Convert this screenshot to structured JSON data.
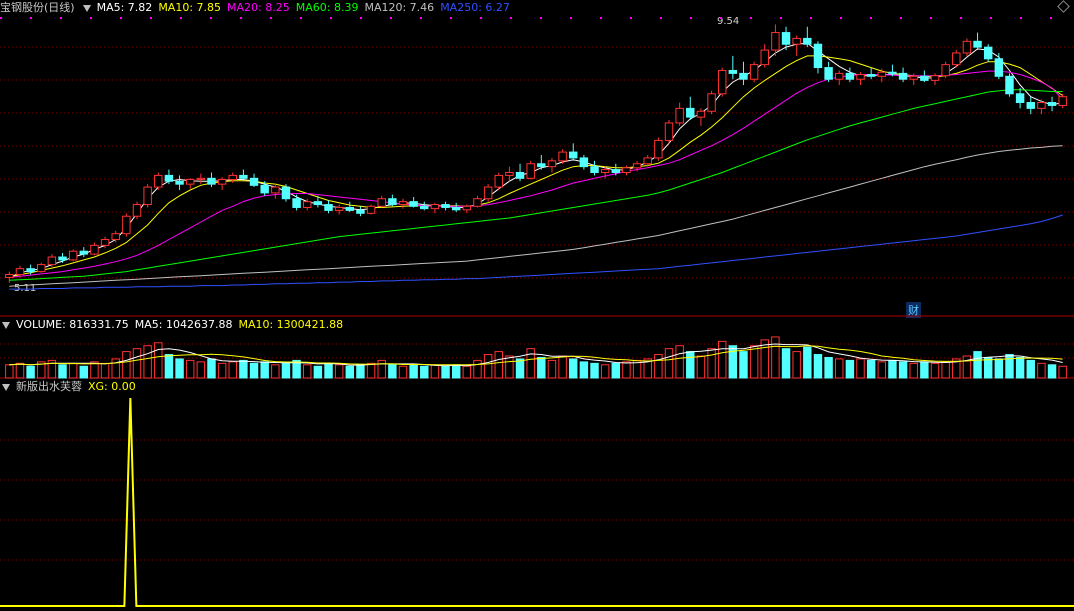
{
  "price_panel": {
    "stock_name": "宝钢股份(日线)",
    "ma_labels": [
      {
        "text": "MA5: 7.82",
        "color": "#ffffff"
      },
      {
        "text": "MA10: 7.85",
        "color": "#ffff00"
      },
      {
        "text": "MA20: 8.25",
        "color": "#ff00ff"
      },
      {
        "text": "MA60: 8.39",
        "color": "#00ff00"
      },
      {
        "text": "MA120: 7.46",
        "color": "#c0c0c0"
      },
      {
        "text": "MA250: 6.27",
        "color": "#3050ff"
      }
    ],
    "high_label": "9.54",
    "low_label": "5.11",
    "event_marker": "财"
  },
  "volume_panel": {
    "label": "VOLUME: 816331.75",
    "ma5": "MA5: 1042637.88",
    "ma10": "MA10: 1300421.88"
  },
  "indicator_panel": {
    "name": "新版出水芙蓉",
    "xg": "XG: 0.00"
  },
  "colors": {
    "up": "#ff3232",
    "down": "#54ffff",
    "grid": "#7a0000",
    "indicator": "#ffff00"
  },
  "chart_data": {
    "type": "candlestick",
    "price_range": [
      5.11,
      9.54
    ],
    "ohlc": [
      [
        5.2,
        5.3,
        5.11,
        5.25
      ],
      [
        5.25,
        5.4,
        5.2,
        5.35
      ],
      [
        5.35,
        5.42,
        5.25,
        5.3
      ],
      [
        5.3,
        5.45,
        5.28,
        5.42
      ],
      [
        5.42,
        5.6,
        5.38,
        5.55
      ],
      [
        5.55,
        5.62,
        5.45,
        5.5
      ],
      [
        5.5,
        5.68,
        5.48,
        5.65
      ],
      [
        5.65,
        5.72,
        5.55,
        5.6
      ],
      [
        5.6,
        5.8,
        5.58,
        5.75
      ],
      [
        5.75,
        5.9,
        5.7,
        5.85
      ],
      [
        5.85,
        6.0,
        5.8,
        5.95
      ],
      [
        5.95,
        6.3,
        5.9,
        6.25
      ],
      [
        6.25,
        6.5,
        6.2,
        6.45
      ],
      [
        6.45,
        6.8,
        6.4,
        6.75
      ],
      [
        6.75,
        7.0,
        6.7,
        6.95
      ],
      [
        6.95,
        7.05,
        6.8,
        6.85
      ],
      [
        6.85,
        6.95,
        6.7,
        6.8
      ],
      [
        6.8,
        6.9,
        6.72,
        6.88
      ],
      [
        6.88,
        6.98,
        6.8,
        6.9
      ],
      [
        6.9,
        7.0,
        6.75,
        6.8
      ],
      [
        6.8,
        6.92,
        6.7,
        6.88
      ],
      [
        6.88,
        7.0,
        6.82,
        6.95
      ],
      [
        6.95,
        7.05,
        6.85,
        6.9
      ],
      [
        6.9,
        6.98,
        6.75,
        6.78
      ],
      [
        6.78,
        6.85,
        6.6,
        6.65
      ],
      [
        6.65,
        6.8,
        6.55,
        6.75
      ],
      [
        6.75,
        6.8,
        6.5,
        6.55
      ],
      [
        6.55,
        6.62,
        6.35,
        6.4
      ],
      [
        6.4,
        6.55,
        6.35,
        6.5
      ],
      [
        6.5,
        6.6,
        6.4,
        6.45
      ],
      [
        6.45,
        6.52,
        6.3,
        6.35
      ],
      [
        6.35,
        6.45,
        6.28,
        6.4
      ],
      [
        6.4,
        6.5,
        6.32,
        6.35
      ],
      [
        6.35,
        6.42,
        6.25,
        6.3
      ],
      [
        6.3,
        6.45,
        6.28,
        6.42
      ],
      [
        6.42,
        6.6,
        6.4,
        6.55
      ],
      [
        6.55,
        6.62,
        6.42,
        6.45
      ],
      [
        6.45,
        6.55,
        6.38,
        6.5
      ],
      [
        6.5,
        6.58,
        6.4,
        6.42
      ],
      [
        6.42,
        6.5,
        6.35,
        6.38
      ],
      [
        6.38,
        6.48,
        6.3,
        6.45
      ],
      [
        6.45,
        6.5,
        6.35,
        6.4
      ],
      [
        6.4,
        6.48,
        6.32,
        6.36
      ],
      [
        6.36,
        6.45,
        6.3,
        6.42
      ],
      [
        6.42,
        6.6,
        6.4,
        6.55
      ],
      [
        6.55,
        6.8,
        6.5,
        6.75
      ],
      [
        6.75,
        7.0,
        6.7,
        6.95
      ],
      [
        6.95,
        7.1,
        6.85,
        7.0
      ],
      [
        7.0,
        7.15,
        6.85,
        6.9
      ],
      [
        6.9,
        7.2,
        6.88,
        7.15
      ],
      [
        7.15,
        7.3,
        7.05,
        7.1
      ],
      [
        7.1,
        7.25,
        7.0,
        7.2
      ],
      [
        7.2,
        7.4,
        7.15,
        7.35
      ],
      [
        7.35,
        7.5,
        7.2,
        7.25
      ],
      [
        7.25,
        7.3,
        7.05,
        7.1
      ],
      [
        7.1,
        7.2,
        6.95,
        7.0
      ],
      [
        7.0,
        7.1,
        6.9,
        7.05
      ],
      [
        7.05,
        7.15,
        6.95,
        7.0
      ],
      [
        7.0,
        7.12,
        6.95,
        7.08
      ],
      [
        7.08,
        7.2,
        7.02,
        7.15
      ],
      [
        7.15,
        7.3,
        7.1,
        7.25
      ],
      [
        7.25,
        7.6,
        7.2,
        7.55
      ],
      [
        7.55,
        7.9,
        7.5,
        7.85
      ],
      [
        7.85,
        8.2,
        7.8,
        8.1
      ],
      [
        8.1,
        8.3,
        7.9,
        7.95
      ],
      [
        7.95,
        8.1,
        7.8,
        8.05
      ],
      [
        8.05,
        8.4,
        8.0,
        8.35
      ],
      [
        8.35,
        8.8,
        8.3,
        8.75
      ],
      [
        8.75,
        9.0,
        8.6,
        8.7
      ],
      [
        8.7,
        8.9,
        8.5,
        8.6
      ],
      [
        8.6,
        8.9,
        8.55,
        8.85
      ],
      [
        8.85,
        9.2,
        8.8,
        9.1
      ],
      [
        9.1,
        9.54,
        9.0,
        9.4
      ],
      [
        9.4,
        9.5,
        9.1,
        9.2
      ],
      [
        9.2,
        9.35,
        9.0,
        9.3
      ],
      [
        9.3,
        9.5,
        9.15,
        9.2
      ],
      [
        9.2,
        9.25,
        8.7,
        8.8
      ],
      [
        8.8,
        8.9,
        8.55,
        8.6
      ],
      [
        8.6,
        8.75,
        8.5,
        8.7
      ],
      [
        8.7,
        8.8,
        8.55,
        8.6
      ],
      [
        8.6,
        8.72,
        8.5,
        8.68
      ],
      [
        8.68,
        8.8,
        8.6,
        8.65
      ],
      [
        8.65,
        8.78,
        8.55,
        8.72
      ],
      [
        8.72,
        8.85,
        8.65,
        8.7
      ],
      [
        8.7,
        8.8,
        8.55,
        8.6
      ],
      [
        8.6,
        8.7,
        8.5,
        8.65
      ],
      [
        8.65,
        8.75,
        8.55,
        8.58
      ],
      [
        8.58,
        8.7,
        8.5,
        8.66
      ],
      [
        8.66,
        8.9,
        8.62,
        8.85
      ],
      [
        8.85,
        9.1,
        8.8,
        9.05
      ],
      [
        9.05,
        9.3,
        9.0,
        9.25
      ],
      [
        9.25,
        9.4,
        9.1,
        9.15
      ],
      [
        9.15,
        9.2,
        8.9,
        8.95
      ],
      [
        8.95,
        9.05,
        8.6,
        8.65
      ],
      [
        8.65,
        8.7,
        8.3,
        8.35
      ],
      [
        8.35,
        8.45,
        8.1,
        8.2
      ],
      [
        8.2,
        8.3,
        8.0,
        8.1
      ],
      [
        8.1,
        8.25,
        8.0,
        8.2
      ],
      [
        8.2,
        8.3,
        8.05,
        8.15
      ],
      [
        8.15,
        8.35,
        8.1,
        8.3
      ]
    ],
    "ma_series": [
      {
        "name": "MA5",
        "values": [
          5.2,
          5.28,
          5.32,
          5.35,
          5.42,
          5.48,
          5.55,
          5.6,
          5.68,
          5.75,
          5.85,
          6.05,
          6.3,
          6.55,
          6.75,
          6.85,
          6.88,
          6.86,
          6.85,
          6.85,
          6.86,
          6.88,
          6.88,
          6.85,
          6.8,
          6.75,
          6.68,
          6.58,
          6.5,
          6.46,
          6.42,
          6.4,
          6.38,
          6.36,
          6.38,
          6.42,
          6.45,
          6.48,
          6.47,
          6.45,
          6.43,
          6.42,
          6.4,
          6.4,
          6.46,
          6.58,
          6.72,
          6.85,
          6.95,
          7.0,
          7.08,
          7.12,
          7.18,
          7.22,
          7.18,
          7.12,
          7.08,
          7.04,
          7.05,
          7.1,
          7.18,
          7.3,
          7.5,
          7.75,
          7.92,
          8.02,
          8.15,
          8.38,
          8.55,
          8.65,
          8.75,
          8.9,
          9.05,
          9.15,
          9.2,
          9.22,
          9.08,
          8.95,
          8.82,
          8.72,
          8.66,
          8.66,
          8.68,
          8.68,
          8.66,
          8.64,
          8.62,
          8.62,
          8.7,
          8.82,
          8.98,
          9.12,
          9.1,
          8.98,
          8.75,
          8.5,
          8.3,
          8.22,
          8.16,
          8.2
        ]
      },
      {
        "name": "MA10",
        "values": [
          5.2,
          5.25,
          5.28,
          5.32,
          5.36,
          5.4,
          5.45,
          5.5,
          5.55,
          5.62,
          5.7,
          5.8,
          5.95,
          6.1,
          6.3,
          6.48,
          6.6,
          6.7,
          6.78,
          6.82,
          6.84,
          6.86,
          6.86,
          6.85,
          6.82,
          6.8,
          6.76,
          6.7,
          6.64,
          6.58,
          6.52,
          6.48,
          6.44,
          6.42,
          6.4,
          6.4,
          6.41,
          6.42,
          6.43,
          6.43,
          6.43,
          6.43,
          6.43,
          6.42,
          6.44,
          6.48,
          6.55,
          6.64,
          6.72,
          6.8,
          6.88,
          6.96,
          7.04,
          7.1,
          7.12,
          7.12,
          7.1,
          7.08,
          7.08,
          7.1,
          7.12,
          7.16,
          7.25,
          7.38,
          7.52,
          7.64,
          7.78,
          7.94,
          8.12,
          8.3,
          8.45,
          8.58,
          8.7,
          8.82,
          8.92,
          9.0,
          9.0,
          8.98,
          8.95,
          8.92,
          8.86,
          8.8,
          8.74,
          8.7,
          8.68,
          8.66,
          8.65,
          8.64,
          8.66,
          8.7,
          8.76,
          8.84,
          8.9,
          8.9,
          8.86,
          8.8,
          8.68,
          8.56,
          8.44,
          8.32
        ]
      },
      {
        "name": "MA20",
        "values": [
          5.2,
          5.22,
          5.24,
          5.26,
          5.28,
          5.3,
          5.33,
          5.36,
          5.39,
          5.43,
          5.47,
          5.52,
          5.58,
          5.66,
          5.75,
          5.85,
          5.95,
          6.05,
          6.15,
          6.25,
          6.35,
          6.42,
          6.5,
          6.56,
          6.6,
          6.62,
          6.64,
          6.64,
          6.64,
          6.62,
          6.6,
          6.58,
          6.56,
          6.54,
          6.52,
          6.5,
          6.48,
          6.46,
          6.44,
          6.43,
          6.42,
          6.42,
          6.42,
          6.42,
          6.43,
          6.45,
          6.48,
          6.52,
          6.56,
          6.6,
          6.65,
          6.7,
          6.76,
          6.82,
          6.86,
          6.9,
          6.94,
          6.98,
          7.02,
          7.05,
          7.08,
          7.12,
          7.16,
          7.22,
          7.3,
          7.38,
          7.46,
          7.55,
          7.65,
          7.76,
          7.88,
          8.0,
          8.12,
          8.24,
          8.36,
          8.46,
          8.54,
          8.6,
          8.64,
          8.66,
          8.68,
          8.68,
          8.68,
          8.67,
          8.66,
          8.66,
          8.66,
          8.66,
          8.67,
          8.68,
          8.7,
          8.72,
          8.74,
          8.74,
          8.72,
          8.68,
          8.62,
          8.55,
          8.45,
          8.25
        ]
      },
      {
        "name": "MA60",
        "values": [
          5.15,
          5.16,
          5.17,
          5.18,
          5.19,
          5.2,
          5.21,
          5.22,
          5.24,
          5.26,
          5.28,
          5.3,
          5.33,
          5.36,
          5.39,
          5.42,
          5.45,
          5.48,
          5.51,
          5.54,
          5.57,
          5.6,
          5.63,
          5.66,
          5.69,
          5.72,
          5.75,
          5.78,
          5.81,
          5.84,
          5.87,
          5.9,
          5.92,
          5.94,
          5.96,
          5.98,
          6.0,
          6.02,
          6.04,
          6.06,
          6.08,
          6.1,
          6.12,
          6.14,
          6.16,
          6.18,
          6.2,
          6.22,
          6.25,
          6.28,
          6.31,
          6.34,
          6.37,
          6.4,
          6.43,
          6.46,
          6.49,
          6.52,
          6.55,
          6.58,
          6.61,
          6.65,
          6.7,
          6.76,
          6.82,
          6.88,
          6.94,
          7.0,
          7.07,
          7.14,
          7.21,
          7.28,
          7.35,
          7.42,
          7.49,
          7.56,
          7.62,
          7.68,
          7.74,
          7.8,
          7.85,
          7.9,
          7.95,
          8.0,
          8.05,
          8.1,
          8.14,
          8.18,
          8.22,
          8.26,
          8.3,
          8.34,
          8.38,
          8.4,
          8.42,
          8.42,
          8.41,
          8.4,
          8.39,
          8.39
        ]
      },
      {
        "name": "MA120",
        "values": [
          5.05,
          5.06,
          5.07,
          5.08,
          5.09,
          5.1,
          5.11,
          5.12,
          5.13,
          5.14,
          5.15,
          5.16,
          5.17,
          5.18,
          5.19,
          5.2,
          5.21,
          5.22,
          5.23,
          5.24,
          5.25,
          5.26,
          5.27,
          5.28,
          5.29,
          5.3,
          5.31,
          5.32,
          5.33,
          5.34,
          5.35,
          5.36,
          5.37,
          5.38,
          5.39,
          5.4,
          5.41,
          5.42,
          5.43,
          5.44,
          5.45,
          5.46,
          5.47,
          5.48,
          5.5,
          5.52,
          5.54,
          5.56,
          5.58,
          5.6,
          5.62,
          5.64,
          5.66,
          5.68,
          5.71,
          5.74,
          5.77,
          5.8,
          5.83,
          5.86,
          5.89,
          5.92,
          5.96,
          6.0,
          6.04,
          6.08,
          6.12,
          6.16,
          6.2,
          6.25,
          6.3,
          6.35,
          6.4,
          6.45,
          6.5,
          6.55,
          6.6,
          6.65,
          6.7,
          6.75,
          6.8,
          6.85,
          6.9,
          6.95,
          7.0,
          7.05,
          7.1,
          7.14,
          7.18,
          7.22,
          7.26,
          7.3,
          7.33,
          7.36,
          7.38,
          7.4,
          7.42,
          7.43,
          7.45,
          7.46
        ]
      },
      {
        "name": "MA250",
        "values": [
          5.0,
          5.0,
          5.0,
          5.01,
          5.01,
          5.01,
          5.02,
          5.02,
          5.02,
          5.03,
          5.03,
          5.03,
          5.04,
          5.04,
          5.04,
          5.05,
          5.05,
          5.05,
          5.06,
          5.06,
          5.06,
          5.07,
          5.07,
          5.08,
          5.08,
          5.09,
          5.09,
          5.1,
          5.1,
          5.11,
          5.11,
          5.12,
          5.12,
          5.13,
          5.13,
          5.14,
          5.14,
          5.15,
          5.15,
          5.16,
          5.16,
          5.17,
          5.17,
          5.18,
          5.18,
          5.19,
          5.2,
          5.21,
          5.22,
          5.23,
          5.24,
          5.25,
          5.26,
          5.27,
          5.28,
          5.29,
          5.3,
          5.31,
          5.32,
          5.33,
          5.34,
          5.35,
          5.37,
          5.39,
          5.41,
          5.43,
          5.45,
          5.47,
          5.49,
          5.51,
          5.53,
          5.55,
          5.57,
          5.59,
          5.61,
          5.63,
          5.65,
          5.67,
          5.69,
          5.71,
          5.73,
          5.75,
          5.77,
          5.79,
          5.81,
          5.83,
          5.85,
          5.87,
          5.89,
          5.91,
          5.94,
          5.97,
          6.0,
          6.03,
          6.06,
          6.09,
          6.12,
          6.16,
          6.21,
          6.27
        ]
      }
    ],
    "volume": [
      0.9,
      1.0,
      0.8,
      1.1,
      1.2,
      0.9,
      1.0,
      0.8,
      1.1,
      1.0,
      1.3,
      1.8,
      2.0,
      2.2,
      2.4,
      1.6,
      1.3,
      1.2,
      1.1,
      1.3,
      1.0,
      1.1,
      1.2,
      1.0,
      1.1,
      0.9,
      1.0,
      1.2,
      0.9,
      0.8,
      1.0,
      0.9,
      0.8,
      0.9,
      1.0,
      1.2,
      0.9,
      0.8,
      0.9,
      0.8,
      0.9,
      0.8,
      0.9,
      0.8,
      1.2,
      1.6,
      1.8,
      1.5,
      1.3,
      2.0,
      1.4,
      1.2,
      1.5,
      1.3,
      1.1,
      1.0,
      0.9,
      1.0,
      1.1,
      1.2,
      1.3,
      1.6,
      2.0,
      2.2,
      1.8,
      1.5,
      2.0,
      2.5,
      2.2,
      1.8,
      2.2,
      2.6,
      2.8,
      2.0,
      1.8,
      2.1,
      1.6,
      1.4,
      1.3,
      1.2,
      1.3,
      1.2,
      1.1,
      1.2,
      1.1,
      1.0,
      1.1,
      1.0,
      1.1,
      1.3,
      1.5,
      1.8,
      1.4,
      1.3,
      1.6,
      1.4,
      1.2,
      1.0,
      0.9,
      0.8
    ],
    "xg_signal_index": 11
  }
}
